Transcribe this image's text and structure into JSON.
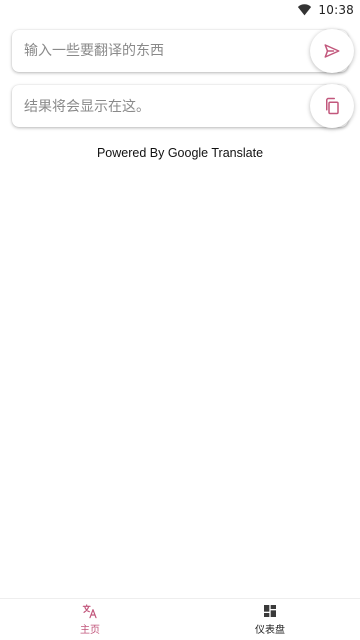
{
  "status_bar": {
    "time": "10:38",
    "wifi_icon": "wifi-icon"
  },
  "translate": {
    "input_placeholder": "输入一些要翻译的东西",
    "send_icon": "send-icon",
    "result_placeholder": "结果将会显示在这。",
    "copy_icon": "copy-icon",
    "powered_by": "Powered By Google Translate"
  },
  "bottom_nav": {
    "items": [
      {
        "label": "主页",
        "icon": "translate-icon",
        "active": true
      },
      {
        "label": "仪表盘",
        "icon": "dashboard-icon",
        "active": false
      }
    ]
  },
  "colors": {
    "accent": "#c2577c",
    "placeholder": "#8a8a8a",
    "inactive_icon": "#3a3a3a"
  }
}
